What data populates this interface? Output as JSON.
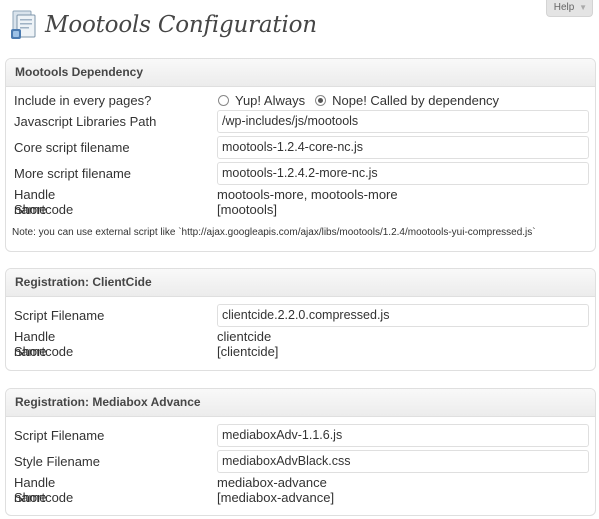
{
  "help_tab": {
    "label": "Help",
    "arrow": "▼"
  },
  "page": {
    "title": "Mootools Configuration"
  },
  "sections": {
    "dependency": {
      "title": "Mootools Dependency",
      "include_label": "Include in every pages?",
      "radio_options": [
        "Yup! Always",
        "Nope! Called by dependency"
      ],
      "radio_selected": "Nope! Called by dependency",
      "lib_path_label": "Javascript Libraries Path",
      "lib_path_value": "/wp-includes/js/mootools",
      "core_label": "Core script filename",
      "core_value": "mootools-1.2.4-core-nc.js",
      "more_label": "More script filename",
      "more_value": "mootools-1.2.4.2-more-nc.js",
      "handle_label": "Handle name",
      "handle_value": "mootools-more, mootools-more",
      "shortcode_label": "Shortcode",
      "shortcode_value": "[mootools]",
      "note": "Note: you can use external script like `http://ajax.googleapis.com/ajax/libs/mootools/1.2.4/mootools-yui-compressed.js`"
    },
    "clientcide": {
      "title": "Registration: ClientCide",
      "script_label": "Script Filename",
      "script_value": "clientcide.2.2.0.compressed.js",
      "handle_label": "Handle name",
      "handle_value": "clientcide",
      "shortcode_label": "Shortcode",
      "shortcode_value": "[clientcide]"
    },
    "mediabox": {
      "title": "Registration: Mediabox Advance",
      "script_label": "Script Filename",
      "script_value": "mediaboxAdv-1.1.6.js",
      "style_label": "Style Filename",
      "style_value": "mediaboxAdvBlack.css",
      "handle_label": "Handle name",
      "handle_value": "mediabox-advance",
      "shortcode_label": "Shortcode",
      "shortcode_value": "[mediabox-advance]"
    }
  },
  "colors": {
    "title": "#464646",
    "text": "#333333",
    "box_border": "#dfdfdf",
    "box_header_top": "#f9f9f9",
    "box_header_bottom": "#ececec"
  },
  "icons": {
    "page_icon": "settings-page-icon",
    "help_arrow": "chevron-down-icon"
  }
}
